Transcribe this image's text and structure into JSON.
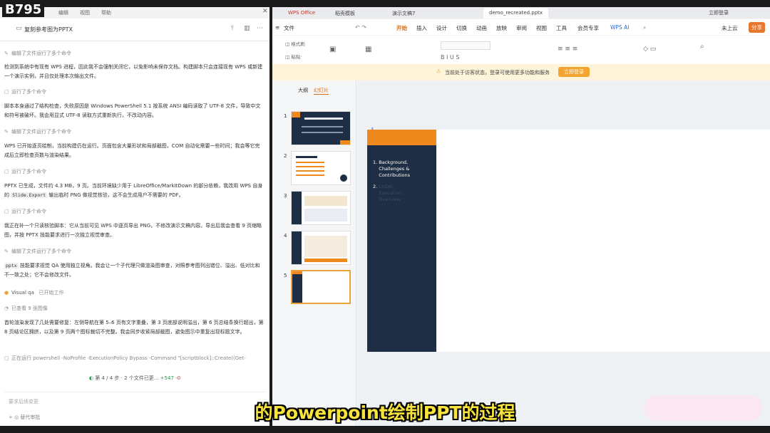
{
  "badge": "B795",
  "subtitle": "的Powerpoint绘制PPT的过程",
  "left": {
    "menu": [
      "编辑",
      "视图",
      "帮助"
    ],
    "title": "复刻参考图为PPTX",
    "entries": [
      {
        "kind": "meta",
        "text": "编辑了文件运行了多个命令"
      },
      {
        "kind": "text",
        "text": "检测到系统中有现有 WPS 进程，因此我不会强制关闭它，以免影响未保存文档。构建脚本只会连接现有 WPS 或新建一个演示实例，并且仅处理本次输出文件。"
      },
      {
        "kind": "meta",
        "text": "运行了多个命令"
      },
      {
        "kind": "text",
        "text": "脚本本身通过了结构检查，失败原因是 Windows PowerShell 5.1 按系统 ANSI 编码读取了 UTF-8 文件，导致中文和符号被破坏。我会用显式 UTF-8 读取方式重新执行，不改动内容。"
      },
      {
        "kind": "meta",
        "text": "编辑了文件运行了多个命令"
      },
      {
        "kind": "text",
        "text": "WPS 已开始逐页绘制，当前构建仍在运行。页面包含大量形状和局部截图，COM 自动化需要一些时间；我会等它完成后立即检查页数与渲染结果。"
      },
      {
        "kind": "meta",
        "text": "运行了多个命令"
      },
      {
        "kind": "text",
        "pre": "PPTX 已生成，文件约 4.3 MB，9 页。当前环境缺少用于 LibreOffice/MarkItDown 的部分依赖，我改用 WPS 自身的 ",
        "code": "Slide.Export",
        "post": " 输出临时 PNG 做视觉核验，这不会生成用户不需要的 PDF。"
      },
      {
        "kind": "meta",
        "text": "运行了多个命令"
      },
      {
        "kind": "text",
        "text": "我正在补一个只读核验脚本：它从当前可见 WPS 中逐页导出 PNG，不修改演示文稿内容。导出后我会查看 9 页缩略图，并按 PPTX 技能要求进行一次独立视觉审查。"
      },
      {
        "kind": "meta",
        "text": "编辑了文件运行了多个命令"
      },
      {
        "kind": "text",
        "code": "pptx",
        "post": " 技能要求视觉 QA 使用独立视角。我会让一个子代理只做渲染图审查，对照参考图列出错位、溢出、低对比和不一致之处；它不会修改文件。"
      },
      {
        "kind": "agent",
        "name": "Visual qa",
        "status": "已开始工作"
      },
      {
        "kind": "meta",
        "text": "已查看 9 张图像"
      },
      {
        "kind": "text",
        "text": "首轮渲染发现了几处需要修复：左侧导航在第 5–6 页有文字重叠，第 3 页底部说明溢出，第 6 页总结条换行超出，第 8 页结论区拥挤，以及第 9 页两个图标裁切不完整。我会同步收紧局部截图，避免图示中重复出现标题文字。"
      },
      {
        "kind": "meta",
        "text": "正在运行 powershell -NoProfile -ExecutionPolicy Bypass -Command \"[scriptblock]::Create((Get-"
      }
    ],
    "progress": {
      "step": "第 4 / 4 步",
      "files": "2 个文件已更...",
      "plus": "+547",
      "minus": "-0"
    },
    "input_placeholder": "要求后续变更",
    "input_bottom": "+   ◎ 替代审批"
  },
  "right": {
    "tabs": [
      "WPS Office",
      "稻壳模板",
      "演示文稿7",
      "demo_recreated.pptx"
    ],
    "login": "立即登录",
    "ribbon_tabs": [
      "文件",
      "开始",
      "插入",
      "设计",
      "切换",
      "动画",
      "放映",
      "审阅",
      "视图",
      "工具",
      "会员专享",
      "WPS AI"
    ],
    "ribbon_right": [
      "未上云",
      "分享"
    ],
    "notice": {
      "message": "当前处于访客状态，登录可使用更多功能和服务",
      "button": "立即登录"
    },
    "thumb_tabs": [
      "大纲",
      "幻灯片"
    ],
    "slide_count": 5,
    "slide_items": [
      {
        "num": "1.",
        "text": "Background, Challenges & Contributions"
      },
      {
        "num": "2.",
        "text": "CUDA... Execution... Overview"
      }
    ]
  },
  "colors": {
    "accent": "#f0891d",
    "navy": "#1e2e44",
    "subtitle": "#f7e33b"
  }
}
